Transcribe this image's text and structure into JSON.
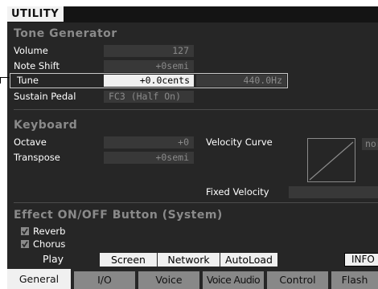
{
  "title": "UTILITY",
  "tone_generator": {
    "heading": "Tone Generator",
    "volume": {
      "label": "Volume",
      "value": "127"
    },
    "note_shift": {
      "label": "Note Shift",
      "value": "+0semi"
    },
    "tune": {
      "label": "Tune",
      "value": "+0.0cents",
      "hz": "440.0Hz"
    },
    "sustain_pedal": {
      "label": "Sustain Pedal",
      "value": "FC3 (Half On)"
    }
  },
  "keyboard": {
    "heading": "Keyboard",
    "octave": {
      "label": "Octave",
      "value": "+0"
    },
    "transpose": {
      "label": "Transpose",
      "value": "+0semi"
    },
    "velocity_curve": {
      "label": "Velocity Curve",
      "value": "normal"
    },
    "fixed_velocity": {
      "label": "Fixed Velocity",
      "value": ""
    }
  },
  "effect": {
    "heading": "Effect ON/OFF Button (System)",
    "reverb": {
      "label": "Reverb",
      "checked": true
    },
    "chorus": {
      "label": "Chorus",
      "checked": true
    }
  },
  "sub_tabs": [
    {
      "label": "Play",
      "active": true
    },
    {
      "label": "Screen",
      "active": false
    },
    {
      "label": "Network",
      "active": false
    },
    {
      "label": "AutoLoad",
      "active": false
    }
  ],
  "info_button": "INFO",
  "main_tabs": [
    {
      "label": "General",
      "active": true
    },
    {
      "label": "I/O",
      "active": false
    },
    {
      "label": "Voice",
      "active": false
    },
    {
      "label": "Voice Audio",
      "active": false
    },
    {
      "label": "Control",
      "active": false
    },
    {
      "label": "Flash",
      "active": false
    }
  ],
  "colors": {
    "screen_bg": "#262626",
    "section_heading": "#8a8a8a",
    "highlight_field": "#f0f0f0",
    "inactive_tab": "#888888"
  }
}
